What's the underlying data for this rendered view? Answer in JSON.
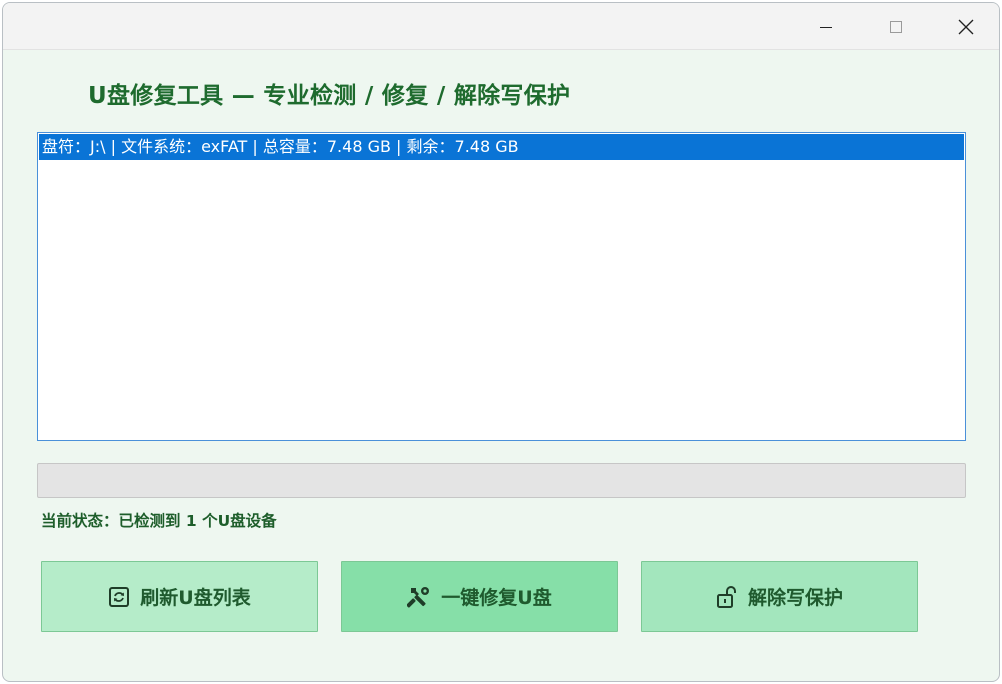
{
  "app": {
    "title": "U盘修复工具 — 专业检测 / 修复 / 解除写保护"
  },
  "drives": [
    {
      "text": "盘符：J:\\ | 文件系统：exFAT | 总容量：7.48 GB | 剩余：7.48 GB",
      "selected": true
    }
  ],
  "progress": {
    "value": 0
  },
  "status": {
    "text": "当前状态：已检测到 1 个U盘设备"
  },
  "buttons": {
    "refresh": {
      "label": "刷新U盘列表",
      "icon": "refresh-icon"
    },
    "repair": {
      "label": "一键修复U盘",
      "icon": "tools-icon"
    },
    "unlock": {
      "label": "解除写保护",
      "icon": "unlock-icon"
    }
  },
  "colors": {
    "title_text": "#1e6b2e",
    "selection": "#0a74d6",
    "background": "#eef7f0"
  }
}
